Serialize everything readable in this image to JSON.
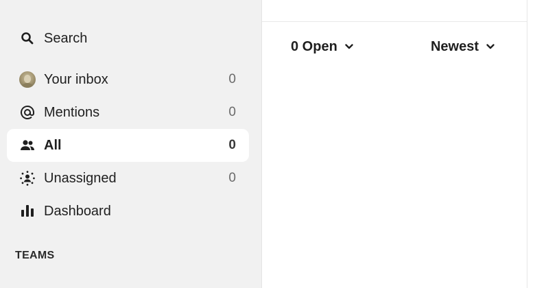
{
  "sidebar": {
    "search_label": "Search",
    "items": [
      {
        "label": "Your inbox",
        "count": "0",
        "icon": "avatar"
      },
      {
        "label": "Mentions",
        "count": "0",
        "icon": "at-icon"
      },
      {
        "label": "All",
        "count": "0",
        "icon": "people-icon",
        "active": true
      },
      {
        "label": "Unassigned",
        "count": "0",
        "icon": "unassigned-icon"
      },
      {
        "label": "Dashboard",
        "count": "",
        "icon": "bar-chart-icon"
      }
    ],
    "teams_heading": "TEAMS"
  },
  "main": {
    "status_filter": "0 Open",
    "sort_filter": "Newest"
  },
  "colors": {
    "sidebar_bg": "#f1f1f1",
    "active_item_bg": "#ffffff",
    "text": "#1f1f1f",
    "count_text": "#6a6a6a"
  }
}
